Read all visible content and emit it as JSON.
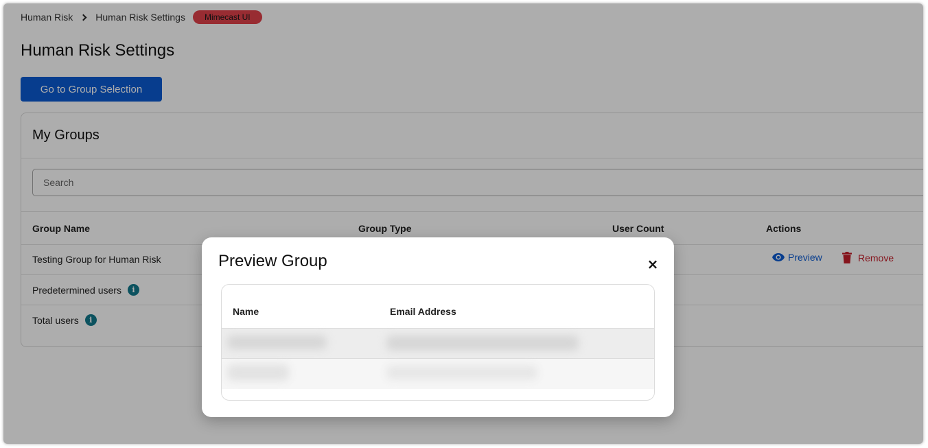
{
  "breadcrumb": {
    "items": [
      "Human Risk",
      "Human Risk Settings"
    ],
    "badge": "Mimecast UI"
  },
  "page": {
    "title": "Human Risk Settings",
    "primary_button": "Go to Group Selection"
  },
  "groups_card": {
    "title": "My Groups",
    "search_placeholder": "Search",
    "columns": [
      "Group Name",
      "Group Type",
      "User Count",
      "Actions"
    ],
    "rows": [
      {
        "name": "Testing Group for Human Risk",
        "preview": "Preview",
        "remove": "Remove"
      },
      {
        "name": "Predetermined users",
        "info": true
      },
      {
        "name": "Total users",
        "info": true
      }
    ]
  },
  "modal": {
    "title": "Preview Group",
    "close_label": "×",
    "columns": [
      "Name",
      "Email Address"
    ]
  },
  "colors": {
    "primary": "#0b5ad1",
    "danger": "#c41e2a",
    "badge": "#e0414b",
    "info": "#127a8c"
  }
}
